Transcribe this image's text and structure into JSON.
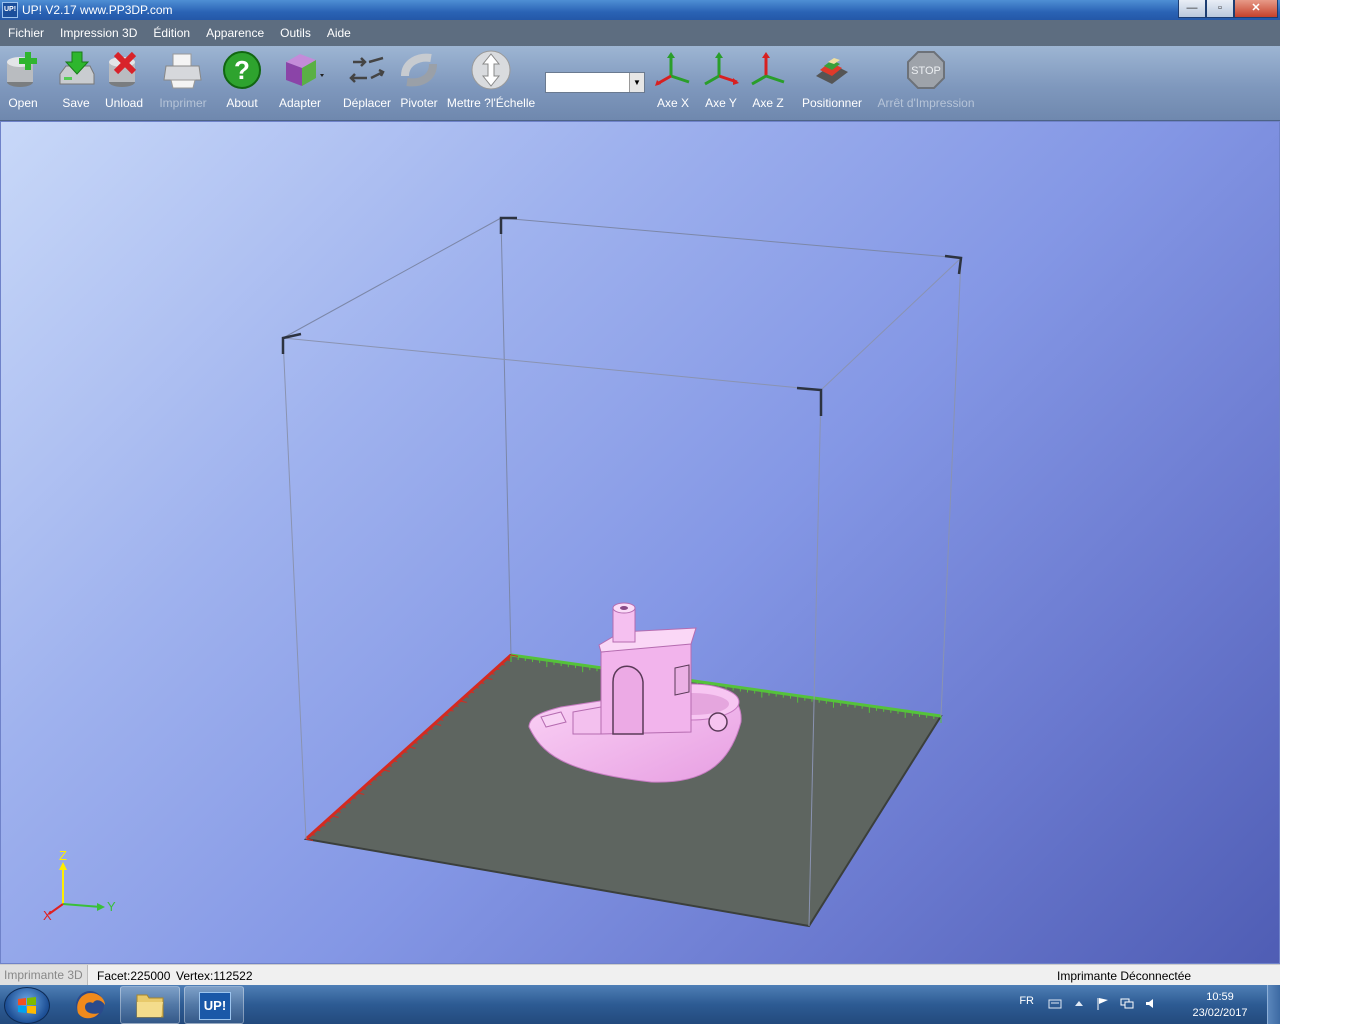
{
  "window": {
    "app_icon_text": "UP!",
    "title": "UP!  V2.17 www.PP3DP.com",
    "buttons": [
      "minimize",
      "maximize",
      "close"
    ]
  },
  "menu": [
    "Fichier",
    "Impression 3D",
    "Édition",
    "Apparence",
    "Outils",
    "Aide"
  ],
  "toolbar": {
    "open": "Open",
    "save": "Save",
    "unload": "Unload",
    "print": "Imprimer",
    "about": "About",
    "fit": "Adapter",
    "move": "Déplacer",
    "rotate": "Pivoter",
    "scale": "Mettre ?l'Échelle",
    "scale_value": "",
    "axis_x": "Axe X",
    "axis_y": "Axe Y",
    "axis_z": "Axe Z",
    "position": "Positionner",
    "stop_sign": "STOP",
    "stop": "Arrêt d'Impression"
  },
  "viewport": {
    "axis_labels": {
      "z": "Z",
      "y": "Y",
      "x": "X"
    },
    "model_color": "#f4b6f0",
    "platform_color": "#5e6560"
  },
  "status": {
    "mode": "Imprimante 3D",
    "facet": "Facet:225000",
    "vertex": "Vertex:112522",
    "printer": "Imprimante Déconnectée"
  },
  "taskbar": {
    "apps": [
      "firefox",
      "explorer",
      "up"
    ],
    "up_label": "UP!",
    "language": "FR",
    "time": "10:59",
    "date": "23/02/2017"
  }
}
